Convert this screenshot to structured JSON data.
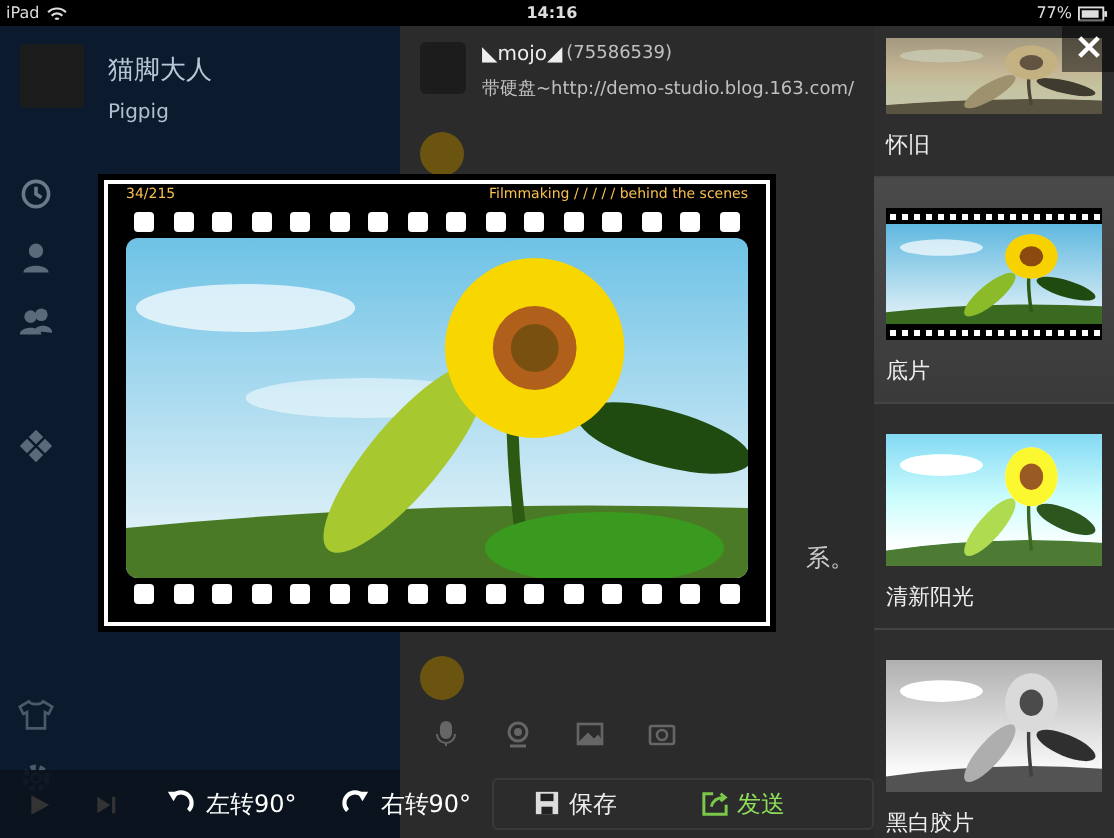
{
  "status_bar": {
    "device": "iPad",
    "time": "14:16",
    "battery": "77%"
  },
  "profile": {
    "name": "猫脚大人",
    "username": "Pigpig"
  },
  "chat": {
    "contact": {
      "name": "◣mojo◢",
      "id": "(75586539)",
      "signature": "带硬盘~http://demo-studio.blog.163.com/"
    },
    "partial_text": "系。"
  },
  "photo_preview": {
    "frame_counter": "34/215",
    "caption": "Filmmaking / / / / / behind the scenes"
  },
  "toolbar": {
    "rotate_left": "左转90°",
    "rotate_right": "右转90°",
    "save": "保存",
    "send": "发送"
  },
  "filters": [
    {
      "label": "怀旧",
      "kind": "vintage",
      "selected": false
    },
    {
      "label": "底片",
      "kind": "film",
      "selected": true
    },
    {
      "label": "清新阳光",
      "kind": "sunny",
      "selected": false
    },
    {
      "label": "黑白胶片",
      "kind": "mono",
      "selected": false
    }
  ]
}
